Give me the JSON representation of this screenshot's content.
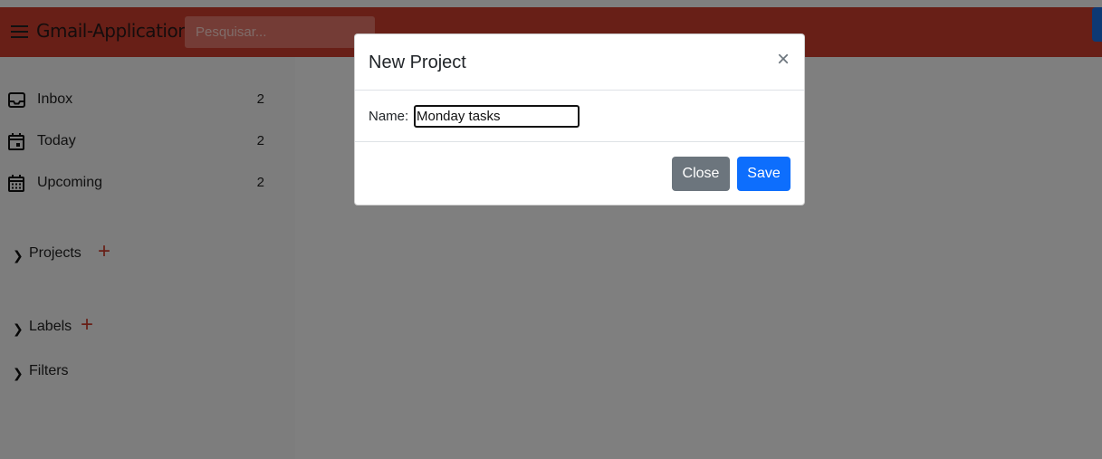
{
  "app": {
    "title": "Gmail-Application",
    "search_placeholder": "Pesquisar..."
  },
  "sidebar": {
    "items": [
      {
        "label": "Inbox",
        "count": "2",
        "icon": "inbox-icon"
      },
      {
        "label": "Today",
        "count": "2",
        "icon": "calendar-today-icon"
      },
      {
        "label": "Upcoming",
        "count": "2",
        "icon": "calendar-upcoming-icon"
      }
    ],
    "sections": [
      {
        "label": "Projects",
        "has_add": true
      },
      {
        "label": "Labels",
        "has_add": true
      },
      {
        "label": "Filters",
        "has_add": false
      }
    ]
  },
  "modal": {
    "title": "New Project",
    "close_symbol": "×",
    "name_label": "Name:",
    "name_value": "Monday tasks",
    "close_label": "Close",
    "save_label": "Save"
  },
  "colors": {
    "topbar": "#d13f2e",
    "accent_plus": "#d13f2e",
    "save_button": "#0d6efd",
    "close_button": "#6c757d"
  }
}
